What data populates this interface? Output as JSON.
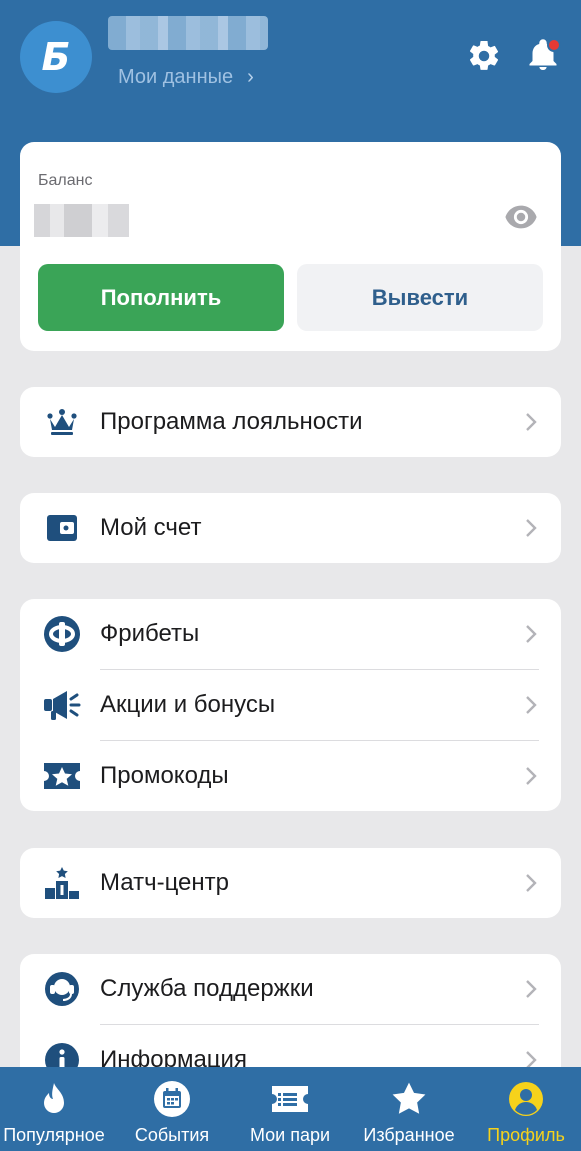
{
  "header": {
    "logo_letter": "Б",
    "my_data_label": "Мои данные",
    "my_data_chevron": "›"
  },
  "balance": {
    "label": "Баланс",
    "deposit_label": "Пополнить",
    "withdraw_label": "Вывести"
  },
  "menu": {
    "loyalty": "Программа лояльности",
    "my_account": "Мой счет",
    "freebets": "Фрибеты",
    "promotions": "Акции и бонусы",
    "promocodes": "Промокоды",
    "match_center": "Матч-центр",
    "support": "Служба поддержки",
    "information": "Информация"
  },
  "tabbar": {
    "popular": "Популярное",
    "events": "События",
    "my_bets": "Мои пари",
    "favorites": "Избранное",
    "profile": "Профиль"
  },
  "colors": {
    "brand_blue": "#2f6ea5",
    "logo_blue": "#3d8fd0",
    "deposit_green": "#3aa457",
    "active_tab_yellow": "#f6d21b",
    "notification_red": "#e53935",
    "icon_blue": "#1f4f7d"
  },
  "icons": [
    "logo-icon",
    "gear-icon",
    "bell-icon",
    "eye-icon",
    "crown-icon",
    "wallet-icon",
    "freebet-icon",
    "megaphone-icon",
    "ticket-star-icon",
    "podium-icon",
    "headset-icon",
    "info-icon",
    "flame-icon",
    "calendar-icon",
    "bets-icon",
    "star-icon",
    "profile-icon",
    "chevron-right-icon"
  ]
}
